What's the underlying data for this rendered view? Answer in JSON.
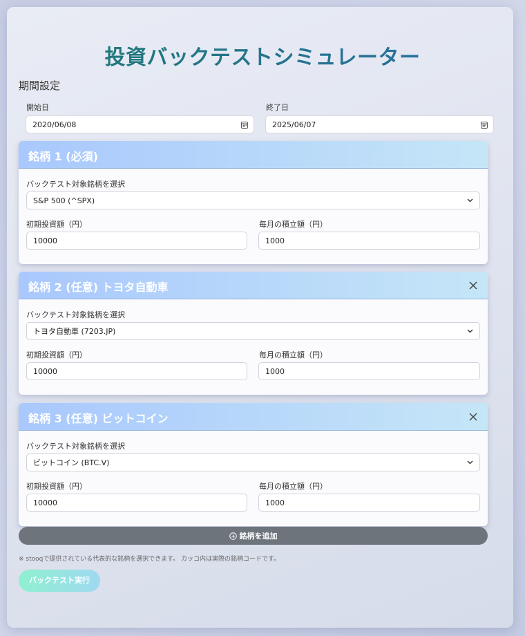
{
  "app": {
    "title": "投資バックテストシミュレーター"
  },
  "period": {
    "heading": "期間設定",
    "start_label": "開始日",
    "start_value": "2020/06/08",
    "end_label": "終了日",
    "end_value": "2025/06/07"
  },
  "stocks": [
    {
      "title": "銘柄 1 (必須)",
      "closable": false,
      "select_label": "バックテスト対象銘柄を選択",
      "selected": "S&P 500 (^SPX)",
      "initial_label": "初期投資額（円）",
      "initial_value": "10000",
      "monthly_label": "毎月の積立額（円）",
      "monthly_value": "1000"
    },
    {
      "title": "銘柄 2 (任意) トヨタ自動車",
      "closable": true,
      "select_label": "バックテスト対象銘柄を選択",
      "selected": "トヨタ自動車 (7203.JP)",
      "initial_label": "初期投資額（円）",
      "initial_value": "10000",
      "monthly_label": "毎月の積立額（円）",
      "monthly_value": "1000"
    },
    {
      "title": "銘柄 3 (任意) ビットコイン",
      "closable": true,
      "select_label": "バックテスト対象銘柄を選択",
      "selected": "ビットコイン (BTC.V)",
      "initial_label": "初期投資額（円）",
      "initial_value": "10000",
      "monthly_label": "毎月の積立額（円）",
      "monthly_value": "1000"
    }
  ],
  "add_button": {
    "label": "銘柄を追加",
    "icon": "plus-circle-icon"
  },
  "note": "※ stooqで提供されている代表的な銘柄を選択できます。 カッコ内は実際の銘柄コードです。",
  "run_button": {
    "label": "バックテスト実行"
  },
  "colors": {
    "title_start": "#1f7a70",
    "title_end": "#2a6fa8",
    "card_head": "#a9c8fd",
    "add_button": "#6e747c",
    "run_button": "#8ff0d0"
  }
}
